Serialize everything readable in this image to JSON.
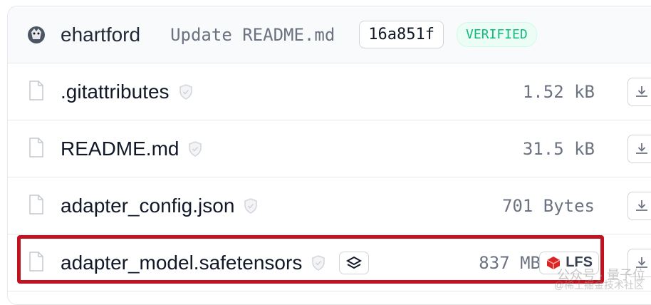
{
  "commit": {
    "author": "ehartford",
    "message": "Update README.md",
    "sha": "16a851f",
    "status": "VERIFIED",
    "avatar_icon": "avatar-icon"
  },
  "files": [
    {
      "name": ".gitattributes",
      "size": "1.52 kB",
      "badge": "",
      "lfs": ""
    },
    {
      "name": "README.md",
      "size": "31.5 kB",
      "badge": "",
      "lfs": ""
    },
    {
      "name": "adapter_config.json",
      "size": "701 Bytes",
      "badge": "",
      "lfs": ""
    },
    {
      "name": "adapter_model.safetensors",
      "size": "837 MB",
      "badge": "stack-icon",
      "lfs": "LFS"
    }
  ],
  "watermark": {
    "line1": "公众号 · 量子位",
    "line2": "@稀土掘金技术社区"
  },
  "colors": {
    "highlight": "#c1121f",
    "verified": "#10b981"
  }
}
